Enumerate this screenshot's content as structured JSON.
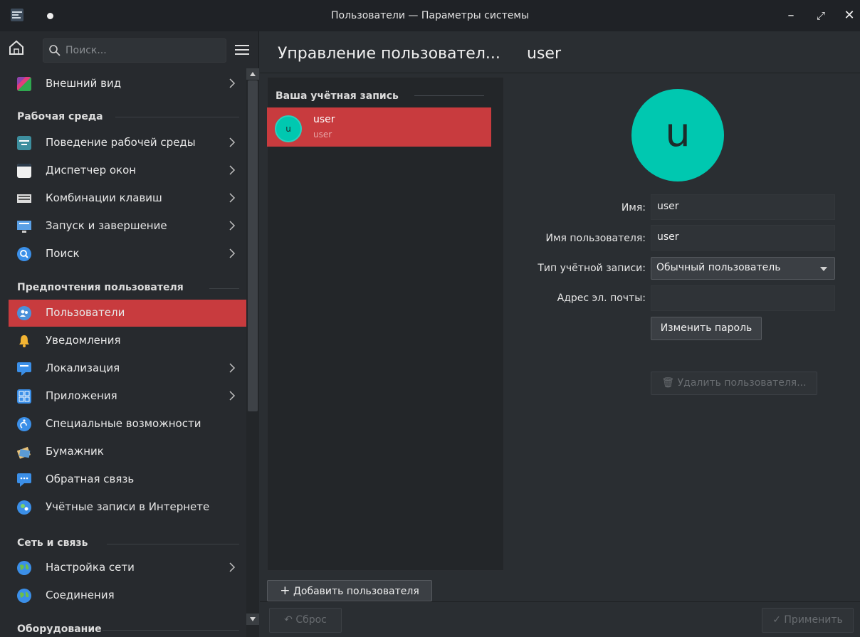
{
  "window": {
    "title": "Пользователи — Параметры системы",
    "controls": {
      "minimize": "–",
      "maximize": "⤢",
      "close": "✕"
    }
  },
  "sidebar": {
    "search_placeholder": "Поиск...",
    "items_top": [
      {
        "label": "Внешний вид",
        "icon": "appearance-icon",
        "chevron": true
      }
    ],
    "categories": [
      {
        "title": "Рабочая среда",
        "items": [
          {
            "label": "Поведение рабочей среды",
            "icon": "desktop-behavior-icon",
            "chevron": true
          },
          {
            "label": "Диспетчер окон",
            "icon": "window-manager-icon",
            "chevron": true
          },
          {
            "label": "Комбинации клавиш",
            "icon": "keyboard-icon",
            "chevron": true
          },
          {
            "label": "Запуск и завершение",
            "icon": "startup-icon",
            "chevron": true
          },
          {
            "label": "Поиск",
            "icon": "search-magnifier-icon",
            "chevron": true
          }
        ]
      },
      {
        "title": "Предпочтения пользователя",
        "items": [
          {
            "label": "Пользователи",
            "icon": "users-icon",
            "chevron": false,
            "selected": true
          },
          {
            "label": "Уведомления",
            "icon": "bell-icon",
            "chevron": false
          },
          {
            "label": "Локализация",
            "icon": "localization-icon",
            "chevron": true
          },
          {
            "label": "Приложения",
            "icon": "applications-icon",
            "chevron": true
          },
          {
            "label": "Специальные возможности",
            "icon": "accessibility-icon",
            "chevron": false
          },
          {
            "label": "Бумажник",
            "icon": "wallet-icon",
            "chevron": false
          },
          {
            "label": "Обратная связь",
            "icon": "feedback-icon",
            "chevron": false
          },
          {
            "label": "Учётные записи в Интернете",
            "icon": "online-accounts-icon",
            "chevron": false
          }
        ]
      },
      {
        "title": "Сеть и связь",
        "items": [
          {
            "label": "Настройка сети",
            "icon": "globe-icon",
            "chevron": true
          },
          {
            "label": "Соединения",
            "icon": "globe-icon",
            "chevron": false
          }
        ]
      },
      {
        "title": "Оборудование",
        "items": []
      }
    ]
  },
  "header": {
    "title": "Управление пользовател...",
    "subtitle": "user"
  },
  "user_list": {
    "section_title": "Ваша учётная запись",
    "users": [
      {
        "initial": "u",
        "name": "user",
        "login": "user"
      }
    ],
    "add_button": "Добавить пользователя"
  },
  "details": {
    "avatar_initial": "u",
    "name_label": "Имя:",
    "name_value": "user",
    "username_label": "Имя пользователя:",
    "username_value": "user",
    "account_type_label": "Тип учётной записи:",
    "account_type_value": "Обычный пользователь",
    "email_label": "Адрес эл. почты:",
    "email_value": "",
    "change_password": "Изменить пароль",
    "delete_user": "Удалить пользователя..."
  },
  "footer": {
    "reset": "Сброс",
    "apply": "Применить"
  },
  "colors": {
    "accent": "#c83b3e",
    "avatar": "#00c8b0",
    "background": "#2a2e32"
  }
}
